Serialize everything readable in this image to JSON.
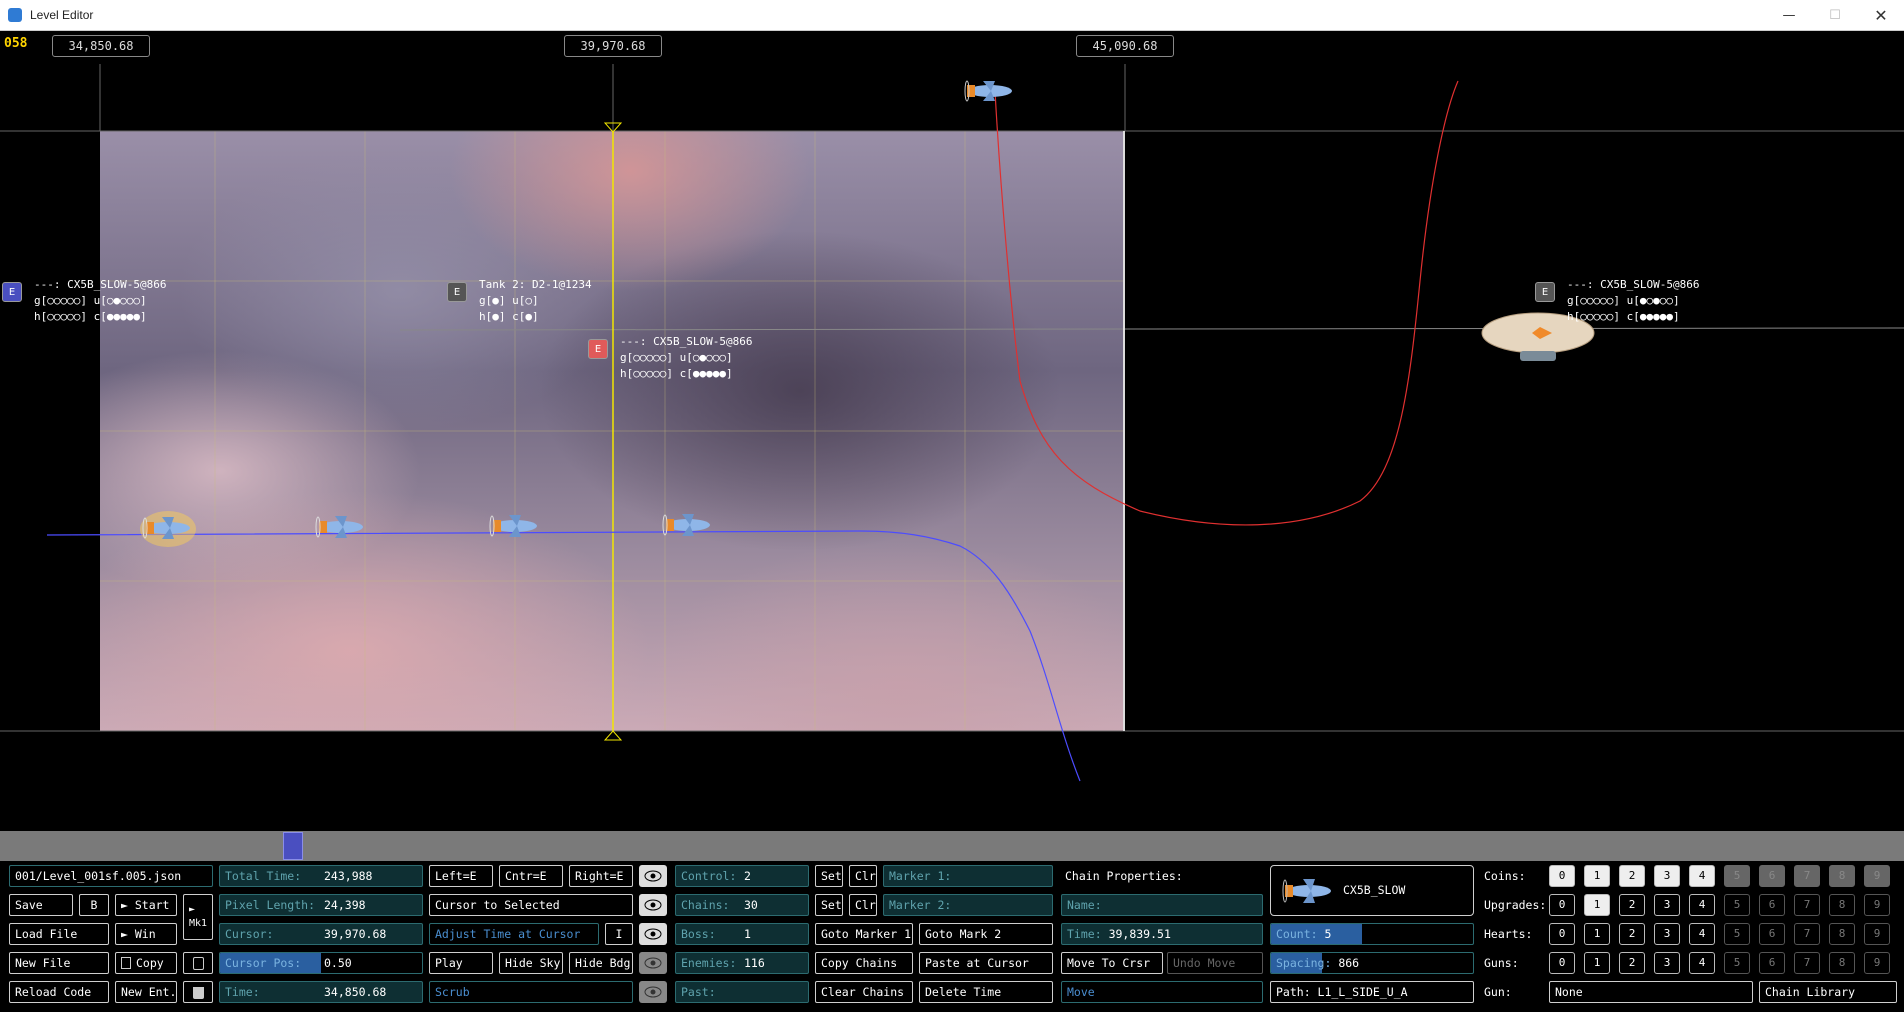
{
  "window": {
    "title": "Level Editor"
  },
  "canvas": {
    "frame": "058",
    "coords": [
      "34,850.68",
      "39,970.68",
      "45,090.68"
    ],
    "entities": [
      {
        "badge": "E",
        "color": "#4a4fc0",
        "line1": "---: CX5B_SLOW-5@866",
        "line2": "g[○○○○○] u[○●○○○]",
        "line3": "h[○○○○○] c[●●●●●]"
      },
      {
        "badge": "E",
        "color": "#555555",
        "line1": "Tank 2: D2-1@1234",
        "line2": "g[●] u[○]",
        "line3": "h[●] c[●]"
      },
      {
        "badge": "E",
        "color": "#e05a5a",
        "line1": "---: CX5B_SLOW-5@866",
        "line2": "g[○○○○○] u[○●○○○]",
        "line3": "h[○○○○○] c[●●●●●]"
      },
      {
        "badge": "E",
        "color": "#555555",
        "line1": "---: CX5B_SLOW-5@866",
        "line2": "g[○○○○○] u[●○●○○]",
        "line3": "h[○○○○○] c[●●●●●]"
      }
    ]
  },
  "panel": {
    "file": "001/Level_001sf.005.json",
    "save": "Save",
    "b": "B",
    "start": "► Start",
    "mk1": "► Mk1",
    "win": "► Win",
    "load": "Load File",
    "new_file": "New File",
    "copy": "Copy",
    "reload": "Reload Code",
    "new_ent": "New Ent.",
    "total_time_k": "Total Time:",
    "total_time_v": "243,988",
    "pixel_length_k": "Pixel Length:",
    "pixel_length_v": "24,398",
    "cursor_k": "Cursor:",
    "cursor_v": "39,970.68",
    "cursor_pos_k": "Cursor Pos:",
    "cursor_pos_v": "0.50",
    "cursor_pos_frac": 0.5,
    "time_k": "Time:",
    "time_v": "34,850.68",
    "left": "Left=E",
    "cntr": "Cntr=E",
    "right": "Right=E",
    "cursor_to_sel": "Cursor to Selected",
    "adjust_time": "Adjust Time at Cursor",
    "i": "I",
    "play": "Play",
    "hide_sky": "Hide Sky",
    "hide_bdg": "Hide Bdg",
    "scrub": "Scrub",
    "control_k": "Control:",
    "control_v": "2",
    "chains_k": "Chains:",
    "chains_v": "30",
    "boss_k": "Boss:",
    "boss_v": "1",
    "enemies_k": "Enemies:",
    "enemies_v": "116",
    "past_k": "Past:",
    "set": "Set",
    "clr": "Clr",
    "marker1": "Marker 1:",
    "marker2": "Marker 2:",
    "goto_marker1": "Goto Marker 1",
    "goto_mark2": "Goto Mark 2",
    "copy_chains": "Copy Chains",
    "paste_cursor": "Paste at Cursor",
    "clear_chains": "Clear Chains",
    "delete_time": "Delete Time",
    "chain_props": "Chain Properties:",
    "name_k": "Name:",
    "ctime_k": "Time:",
    "ctime_v": "39,839.51",
    "move_crsr": "Move To Crsr",
    "undo_move": "Undo Move",
    "move": "Move",
    "enemy_name": "CX5B_SLOW",
    "count_k": "Count:",
    "count_v": "5",
    "count_frac": 0.45,
    "spacing_k": "Spacing:",
    "spacing_v": "866",
    "spacing_frac": 0.25,
    "path": "Path: L1_L_SIDE_U_A",
    "coins_lbl": "Coins:",
    "upgrades_lbl": "Upgrades:",
    "hearts_lbl": "Hearts:",
    "guns_lbl": "Guns:",
    "gun_lbl": "Gun:",
    "gun_value": "None",
    "chain_library": "Chain Library",
    "digits": [
      "0",
      "1",
      "2",
      "3",
      "4",
      "5",
      "6",
      "7",
      "8",
      "9"
    ]
  }
}
